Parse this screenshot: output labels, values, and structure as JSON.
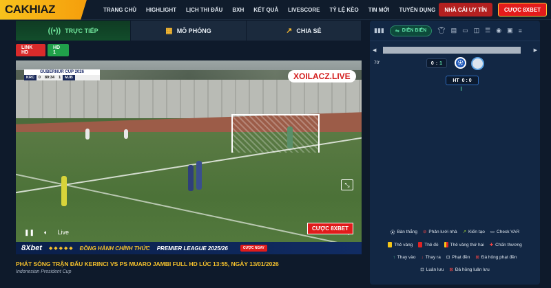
{
  "header": {
    "logo": "CAKHIAZ",
    "nav": [
      "TRANG CHỦ",
      "HIGHLIGHT",
      "LỊCH THI ĐẤU",
      "BXH",
      "KẾT QUẢ",
      "LIVESCORE",
      "TỶ LỆ KÈO",
      "TIN MỚI",
      "TUYỂN DỤNG"
    ],
    "btn_nha_cai": "NHÀ CÁI UY TÍN",
    "btn_cuoc": "CƯỢC 8XBET"
  },
  "tabs": {
    "live": "TRỰC TIẾP",
    "sim": "MÔ PHỎNG",
    "share": "CHIA SẺ"
  },
  "sources": {
    "link_hd": "LINK HD",
    "hd1": "HD 1"
  },
  "video": {
    "score_title": "GUBERNUR CUP 2026",
    "team_home": "KRC",
    "score_home": "0",
    "clock": "89:34",
    "score_away": "1",
    "team_away": "MJB",
    "watermark": "XOILACZ.LIVE",
    "live_label": "Live",
    "cuoc_btn": "CƯỢC 8XBET",
    "banner_brand": "8Xbet",
    "banner_text": "ĐỒNG HÀNH CHÍNH THỨC",
    "banner_league": "PREMIER LEAGUE 2025/26",
    "banner_cta": "CƯỢC NGAY"
  },
  "match": {
    "title": "PHÁT SÓNG TRẬN ĐẤU KERINCI VS PS MUARO JAMBI FULL HD LÚC 13:55, NGÀY 13/01/2026",
    "league": "Indonesian President Cup"
  },
  "panel": {
    "active_tab": "DIỄN BIẾN",
    "minute": "70'",
    "score_live_home": "0",
    "score_live_sep": ":",
    "score_live_away": "1",
    "ht_label": "HT",
    "ht_score": "0 : 0",
    "legend": [
      [
        "Bàn thắng",
        "Phản lưới nhà",
        "Kiến tạo",
        "Check VAR"
      ],
      [
        "Thẻ vàng",
        "Thẻ đỏ",
        "Thẻ vàng thứ hai",
        "Chấn thương"
      ],
      [
        "Thay vào",
        "Thay ra",
        "Phạt đền",
        "Đá hỏng phạt đền"
      ],
      [
        "Luân lưu",
        "Đá hỏng luân lưu"
      ]
    ]
  }
}
